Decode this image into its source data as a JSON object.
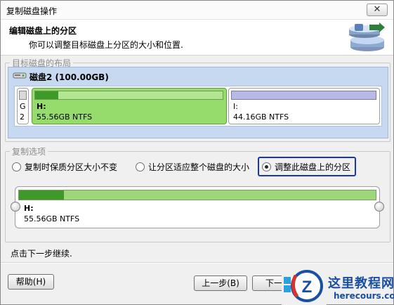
{
  "window": {
    "title": "复制磁盘操作",
    "close_glyph": "✕"
  },
  "header": {
    "title": "编辑磁盘上的分区",
    "subtitle": "你可以调整目标磁盘上分区的大小和位置.",
    "icon": "disk-copy-icon"
  },
  "layout_group": {
    "legend": "目标磁盘的布局",
    "disk_name": "磁盘2 (100.00GB)",
    "partitions": [
      {
        "letter": "G",
        "sub": "2",
        "bar_fill_percent": 0,
        "color": "#c8c8c8"
      },
      {
        "letter": "H:",
        "size": "55.56GB NTFS",
        "bar_fill_percent": 16,
        "selected": true,
        "color": "#5fbf3b"
      },
      {
        "letter": "I:",
        "size": "44.16GB NTFS",
        "bar_fill_percent": 0,
        "color": "#b9b9e6"
      }
    ]
  },
  "copy_options": {
    "legend": "复制选项",
    "options": [
      {
        "label": "复制时保质分区大小不变",
        "selected": false
      },
      {
        "label": "让分区适应整个磁盘的大小",
        "selected": false
      },
      {
        "label": "调整此磁盘上的分区",
        "selected": true
      }
    ],
    "preview": {
      "letter": "H:",
      "size": "55.56GB NTFS",
      "bar_fill_percent": 12
    }
  },
  "status_text": "点击下一步继续.",
  "buttons": {
    "help": "帮助(H)",
    "back": "上一步(B)",
    "next": "下一步"
  },
  "watermark": {
    "text": "这里教程网",
    "url": "herecours.com",
    "brand_color": "#1b4fa1"
  }
}
